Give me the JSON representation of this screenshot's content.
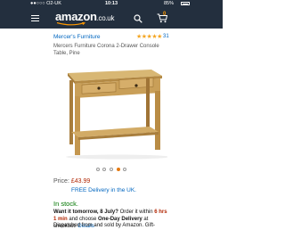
{
  "status_bar": {
    "carrier": "●●○○○ O2-UK",
    "time": "10:13",
    "battery": "85%"
  },
  "header": {
    "logo_main": "amazon",
    "logo_tld": ".co.uk",
    "cart_count": "0",
    "brand_color": "#232f3e",
    "accent_color": "#ff9900"
  },
  "product": {
    "seller": "Mercer's Furniture",
    "rating_stars": "★★★★★",
    "rating_count": "31",
    "title": "Mercers Furniture Corona 2-Drawer Console Table, Pine",
    "image_icon": "console-table-image"
  },
  "carousel": {
    "count": 5,
    "active_index": 3
  },
  "pricing": {
    "price_label": "Price:",
    "price": "£43.99",
    "delivery": "FREE Delivery in the UK."
  },
  "availability": {
    "stock": "In stock.",
    "order_part1": "Want it tomorrow, 8 July?",
    "order_part2": "Order it within",
    "order_countdown": "6 hrs 1 min",
    "order_part3": "and choose",
    "order_delivery": "One-Day Delivery",
    "order_part4": "at checkout.",
    "details_link": "Details",
    "dispatch": "Dispatched from and sold by Amazon. Gift-"
  }
}
